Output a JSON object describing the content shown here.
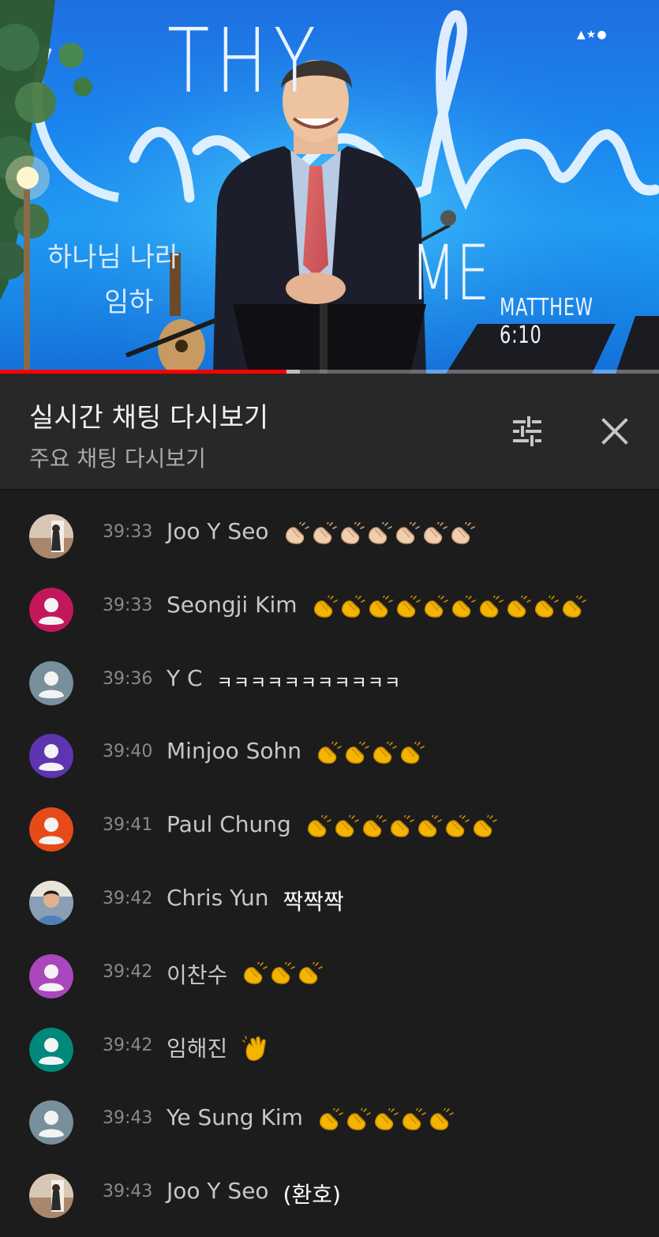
{
  "video": {
    "thy": "THY",
    "me": "ME",
    "verse": "MATTHEW 6:10",
    "lyric_line1": "하나님 나라",
    "lyric_line2": "임하",
    "logo": "▲★●",
    "progress": 0.435,
    "buffered": 0.455
  },
  "chat_header": {
    "title": "실시간 채팅 다시보기",
    "subtitle": "주요 채팅 다시보기",
    "filter_icon": "tune-icon",
    "close_icon": "close-icon"
  },
  "messages": [
    {
      "time": "39:33",
      "author": "Joo Y Seo",
      "text": "",
      "emoji": "clap-light",
      "count": 7,
      "avatar": "photo-woman",
      "avatar_color": "#c9a48a"
    },
    {
      "time": "39:33",
      "author": "Seongji Kim",
      "text": "",
      "emoji": "clap-yellow",
      "count": 10,
      "avatar": "default",
      "avatar_color": "#c2185b"
    },
    {
      "time": "39:36",
      "author": "Y C",
      "text": "ㅋㅋㅋㅋㅋㅋㅋㅋㅋㅋㅋ",
      "emoji": "",
      "count": 0,
      "avatar": "default",
      "avatar_color": "#78909c"
    },
    {
      "time": "39:40",
      "author": "Minjoo Sohn",
      "text": "",
      "emoji": "clap-yellow",
      "count": 4,
      "avatar": "default",
      "avatar_color": "#5e35b1"
    },
    {
      "time": "39:41",
      "author": "Paul Chung",
      "text": "",
      "emoji": "clap-yellow",
      "count": 7,
      "avatar": "default",
      "avatar_color": "#e64a19"
    },
    {
      "time": "39:42",
      "author": "Chris Yun",
      "text": "짝짝짝",
      "emoji": "",
      "count": 0,
      "avatar": "photo-man",
      "avatar_color": "#8a9fb5"
    },
    {
      "time": "39:42",
      "author": "이찬수",
      "text": "",
      "emoji": "clap-yellow",
      "count": 3,
      "avatar": "default",
      "avatar_color": "#ab47bc"
    },
    {
      "time": "39:42",
      "author": "임해진",
      "text": "",
      "emoji": "wave",
      "count": 1,
      "avatar": "default",
      "avatar_color": "#00897b"
    },
    {
      "time": "39:43",
      "author": "Ye Sung Kim",
      "text": "",
      "emoji": "clap-yellow",
      "count": 5,
      "avatar": "default",
      "avatar_color": "#78909c"
    },
    {
      "time": "39:43",
      "author": "Joo Y Seo",
      "text": "(환호)",
      "emoji": "",
      "count": 0,
      "avatar": "photo-woman",
      "avatar_color": "#c9a48a"
    }
  ]
}
